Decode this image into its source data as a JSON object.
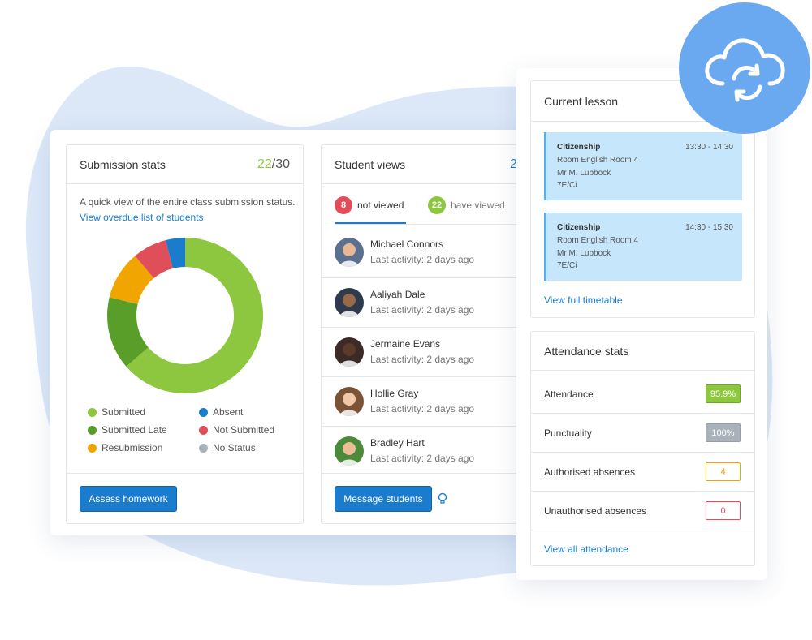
{
  "colors": {
    "accent": "#1b7ccd",
    "submitted": "#8dc63f",
    "submitted_late": "#5a9e2a",
    "resubmission": "#f0a500",
    "not_submitted": "#e04e5a",
    "absent": "#1b7ccd",
    "no_status": "#a9b2bb",
    "blob": "#dce8f8",
    "cloud_circle": "#6aa9ef"
  },
  "submission": {
    "title": "Submission stats",
    "count_done": "22",
    "count_total": "/30",
    "description": "A quick view of the entire class submission status.",
    "overdue_link": "View overdue list of students",
    "legend": [
      {
        "label": "Submitted",
        "color": "#8dc63f"
      },
      {
        "label": "Absent",
        "color": "#1b7ccd"
      },
      {
        "label": "Submitted Late",
        "color": "#5a9e2a"
      },
      {
        "label": "Not Submitted",
        "color": "#e04e5a"
      },
      {
        "label": "Resubmission",
        "color": "#f0a500"
      },
      {
        "label": "No Status",
        "color": "#a9b2bb"
      }
    ],
    "assess_button": "Assess homework"
  },
  "chart_data": {
    "type": "pie",
    "donut": true,
    "categories": [
      "Submitted",
      "Submitted Late",
      "Resubmission",
      "Not Submitted",
      "Absent"
    ],
    "values": [
      63,
      15,
      10,
      7,
      4
    ],
    "unit": "%",
    "colors": [
      "#8dc63f",
      "#5a9e2a",
      "#f0a500",
      "#e04e5a",
      "#1b7ccd"
    ]
  },
  "student_views": {
    "title": "Student views",
    "count_partial": "2",
    "tab_not_viewed": {
      "count": "8",
      "label": "not viewed"
    },
    "tab_viewed": {
      "count": "22",
      "label": "have viewed"
    },
    "students": [
      {
        "name": "Michael Connors",
        "activity": "Last activity: 2 days ago",
        "avatar_color": "#5b6f8e",
        "skin": "#e8b894"
      },
      {
        "name": "Aaliyah Dale",
        "activity": "Last activity: 2 days ago",
        "avatar_color": "#2f3a4d",
        "skin": "#9a6a48"
      },
      {
        "name": "Jermaine Evans",
        "activity": "Last activity: 2 days ago",
        "avatar_color": "#3b2a26",
        "skin": "#5b3a2a"
      },
      {
        "name": "Hollie Gray",
        "activity": "Last activity: 2 days ago",
        "avatar_color": "#7a5236",
        "skin": "#f0c8a8"
      },
      {
        "name": "Bradley Hart",
        "activity": "Last activity: 2 days ago",
        "avatar_color": "#4a8a3a",
        "skin": "#edbd98"
      }
    ],
    "message_button": "Message students",
    "hint_icon": "lightbulb-icon"
  },
  "current_lesson": {
    "title": "Current lesson",
    "lessons": [
      {
        "subject": "Citizenship",
        "time": "13:30 - 14:30",
        "room": "Room English Room 4",
        "teacher": "Mr M. Lubbock",
        "class": "7E/Ci"
      },
      {
        "subject": "Citizenship",
        "time": "14:30 - 15:30",
        "room": "Room English Room 4",
        "teacher": "Mr M. Lubbock",
        "class": "7E/Ci"
      }
    ],
    "timetable_link": "View full timetable"
  },
  "attendance": {
    "title": "Attendance stats",
    "rows": [
      {
        "label": "Attendance",
        "value": "95.9%",
        "style": "solid-green"
      },
      {
        "label": "Punctuality",
        "value": "100%",
        "style": "solid-grey"
      },
      {
        "label": "Authorised absences",
        "value": "4",
        "style": "outline-orange"
      },
      {
        "label": "Unauthorised absences",
        "value": "0",
        "style": "outline-red"
      }
    ],
    "all_link": "View all attendance"
  },
  "sync_icon": "cloud-sync-icon"
}
